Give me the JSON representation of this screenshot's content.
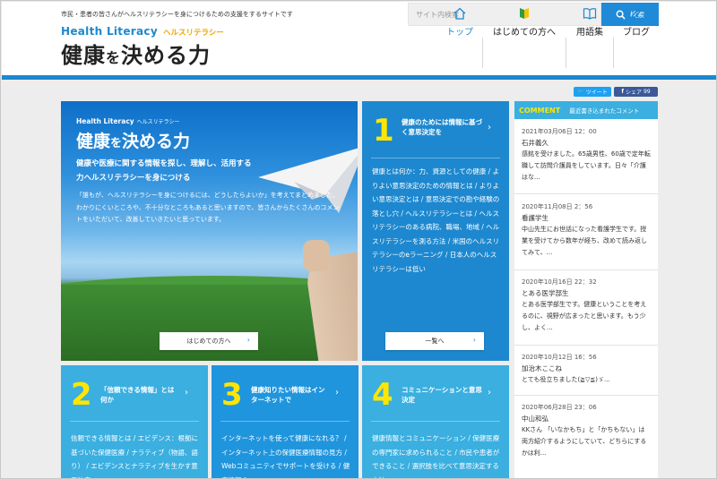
{
  "header": {
    "tagline": "市民・患者の皆さんがヘルスリテラシーを身につけるための支援をするサイトです",
    "search_placeholder": "サイト内検索",
    "search_button": "検索",
    "logo_en": "Health Literacy",
    "logo_kana": "ヘルスリテラシー",
    "logo_jp_a": "健康",
    "logo_jp_b": "を",
    "logo_jp_c": "決める力"
  },
  "nav": {
    "items": [
      {
        "label": "トップ",
        "icon": "home-icon",
        "active": true
      },
      {
        "label": "はじめての方へ",
        "icon": "beginner-mark-icon"
      },
      {
        "label": "用語集",
        "icon": "book-icon"
      },
      {
        "label": "ブログ",
        "icon": "pencil-icon"
      }
    ]
  },
  "share": {
    "tweet": "ツイート",
    "facebook": "シェア",
    "facebook_count": "99"
  },
  "hero": {
    "en": "Health Literacy",
    "kana": "ヘルスリテラシー",
    "title_a": "健康",
    "title_b": "を",
    "title_c": "決める力",
    "sub": "健康や医療に関する情報を探し、理解し、活用する力ヘルスリテラシーを身につける",
    "desc": "「誰もが、ヘルスリテラシーを身につけるには、どうしたらよいか」を考えてまとめました。わかりにくいところや、不十分なところもあると思いますので、皆さんからたくさんのコメントをいただいて、改善していきたいと思っています。",
    "button": "はじめての方へ"
  },
  "cards": {
    "card1": {
      "num": "1",
      "title": "健康のためには情報に基づく意思決定を",
      "links": "健康とは何か：力、資源としての健康 / よりよい意思決定のための情報とは / よりよい意思決定とは / 意思決定での勘や経験の落とし穴 / ヘルスリテラシーとは / ヘルスリテラシーのある病院、職場、地域 / ヘルスリテラシーを測る方法 / 米国のヘルスリテラシーのeラーニング / 日本人のヘルスリテラシーは低い",
      "button": "一覧へ"
    },
    "card2": {
      "num": "2",
      "title": "「信頼できる情報」とは何か",
      "links": "信頼できる情報とは / エビデンス：根拠に基づいた保健医療 / ナラティブ（物語、語り） / エビデンスとナラティブを生かす意思決定"
    },
    "card3": {
      "num": "3",
      "title": "健康知りたい情報はインターネットで",
      "links": "インターネットを使って健康になれる？ / インターネット上の保健医療情報の見方 / Webコミュニティでサポートを受ける / 健康情報の…"
    },
    "card4": {
      "num": "4",
      "title": "コミュニケーションと意思決定",
      "links": "健康情報とコミュニケーション / 保健医療の専門家に求められること / 市民や患者ができること / 選択肢を比べて意思決定する方法"
    }
  },
  "sidebar": {
    "head_label": "COMMENT",
    "head_sub": "最近書き込まれたコメント",
    "comments": [
      {
        "date": "2021年03月06日 12：00",
        "author": "石井義久",
        "text": "感銘を受けました。65歳男性、60歳で定年転職して訪問介護員をしています。日々「介護はな..."
      },
      {
        "date": "2020年11月08日 2：56",
        "author": "看護学生",
        "text": "中山先生にお世話になった看護学生です。授業を受けてから数年が経ち、改めて読み返してみて、..."
      },
      {
        "date": "2020年10月16日 22：32",
        "author": "とある医学部生",
        "text": "とある医学部生です。健康ということを考えるのに、視野が広まったと思います。もう少し、よく..."
      },
      {
        "date": "2020年10月12日 16：56",
        "author": "加治木ここね",
        "text": "とても役立ちました(≧▽≦)ゞ..."
      },
      {
        "date": "2020年06月28日 23：06",
        "author": "中山和弘",
        "text": "KKさん 「いなかもち」と「かちもない」は両方紹介するようにしていて、どちらにするかは利..."
      }
    ]
  },
  "colors": {
    "accent": "#1d88cf",
    "card_light": "#3aafe0",
    "number_yellow": "#ffe600"
  }
}
